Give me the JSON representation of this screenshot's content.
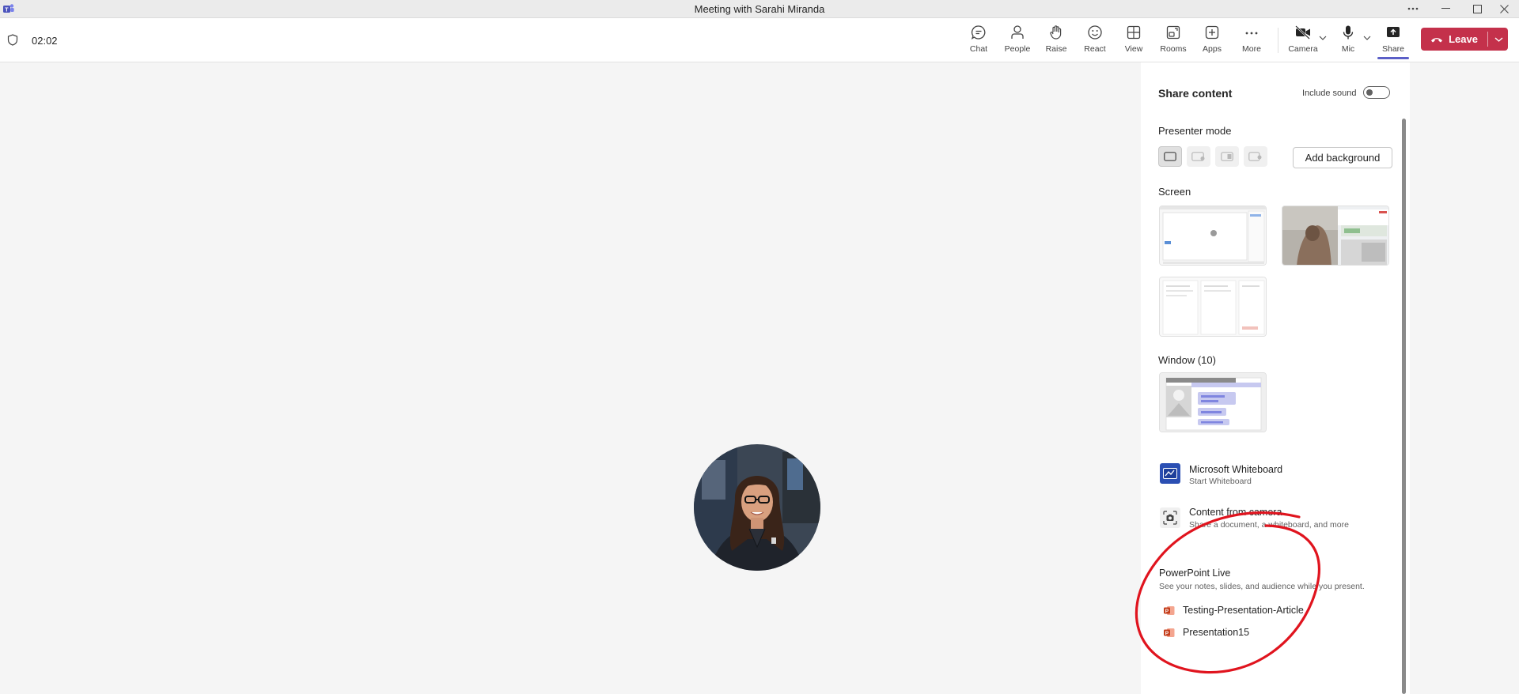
{
  "window": {
    "title": "Meeting with Sarahi Miranda",
    "app_icon": "teams-logo-icon",
    "controls": [
      "more-options-icon",
      "minimize-icon",
      "maximize-icon",
      "close-icon"
    ]
  },
  "meeting": {
    "timer": "02:02",
    "toolbar": [
      {
        "label": "Chat",
        "icon": "chat-icon"
      },
      {
        "label": "People",
        "icon": "people-icon"
      },
      {
        "label": "Raise",
        "icon": "raise-hand-icon"
      },
      {
        "label": "React",
        "icon": "react-icon"
      },
      {
        "label": "View",
        "icon": "view-icon"
      },
      {
        "label": "Rooms",
        "icon": "rooms-icon"
      },
      {
        "label": "Apps",
        "icon": "apps-icon"
      },
      {
        "label": "More",
        "icon": "more-icon"
      },
      {
        "label": "Camera",
        "icon": "camera-off-icon"
      },
      {
        "label": "Mic",
        "icon": "mic-icon"
      },
      {
        "label": "Share",
        "icon": "share-icon"
      }
    ],
    "leave_label": "Leave",
    "colors": {
      "leave": "#c4314b",
      "accent": "#5b5fc7"
    }
  },
  "share_panel": {
    "title": "Share content",
    "include_sound_label": "Include sound",
    "include_sound_on": false,
    "presenter_mode_label": "Presenter mode",
    "add_background_label": "Add background",
    "screen_label": "Screen",
    "window_label": "Window (10)",
    "options": [
      {
        "title": "Microsoft Whiteboard",
        "subtitle": "Start Whiteboard",
        "icon": "whiteboard-icon"
      },
      {
        "title": "Content from camera",
        "subtitle": "Share a document, a whiteboard, and more",
        "icon": "camera-content-icon"
      }
    ],
    "powerpoint": {
      "title": "PowerPoint Live",
      "subtitle": "See your notes, slides, and audience while you present.",
      "files": [
        "Testing-Presentation-Article",
        "Presentation15"
      ]
    }
  },
  "annotation": {
    "color": "#e0141e"
  }
}
